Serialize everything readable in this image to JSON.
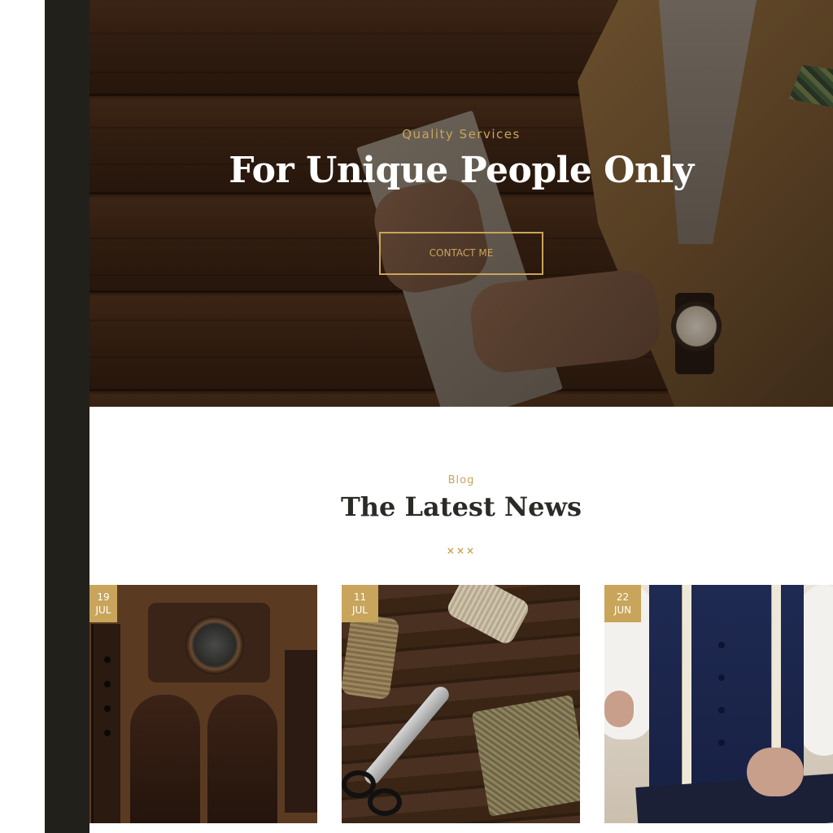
{
  "hero": {
    "kicker": "Quality Services",
    "title": "For Unique People Only",
    "button_label": "CONTACT ME"
  },
  "blog": {
    "kicker": "Blog",
    "title": "The Latest News",
    "divider": "×××",
    "posts": [
      {
        "day": "19",
        "month": "JUL",
        "image": "leather-goods-photo"
      },
      {
        "day": "11",
        "month": "JUL",
        "image": "sewing-tools-photo"
      },
      {
        "day": "22",
        "month": "JUN",
        "image": "tailor-measuring-photo"
      }
    ]
  },
  "colors": {
    "accent": "#c8a55a",
    "sidebar": "#22201b",
    "heading": "#2b2a26"
  }
}
